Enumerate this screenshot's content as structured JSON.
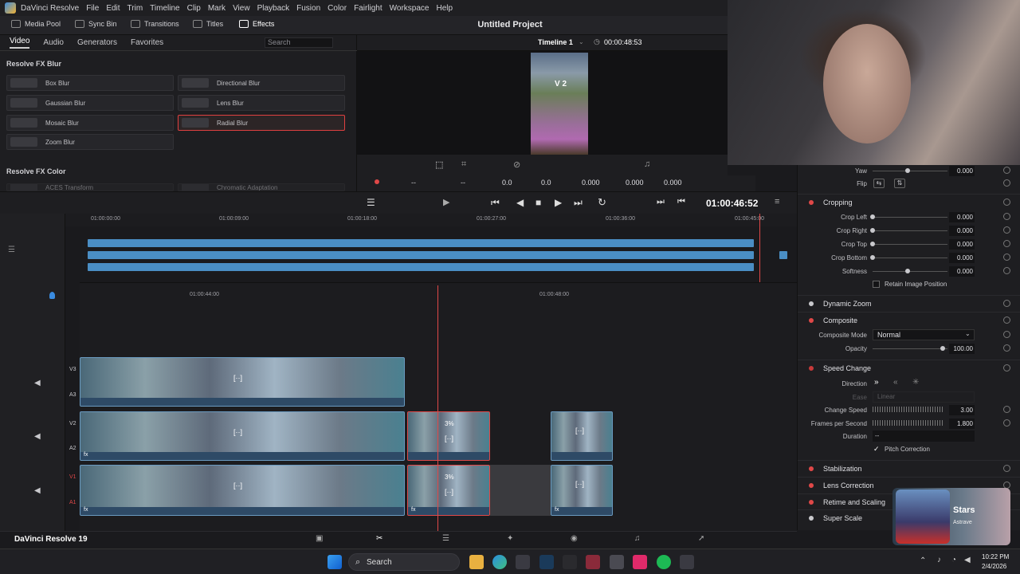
{
  "menu": [
    "DaVinci Resolve",
    "File",
    "Edit",
    "Trim",
    "Timeline",
    "Clip",
    "Mark",
    "View",
    "Playback",
    "Fusion",
    "Color",
    "Fairlight",
    "Workspace",
    "Help"
  ],
  "toolbar": {
    "media_pool": "Media Pool",
    "sync_bin": "Sync Bin",
    "transitions": "Transitions",
    "titles": "Titles",
    "effects": "Effects",
    "project": "Untitled Project",
    "timeline": "Timeline 1",
    "timecode": "00:00:48:53"
  },
  "library": {
    "tabs": [
      "Video",
      "Audio",
      "Generators",
      "Favorites"
    ],
    "search_placeholder": "Search",
    "section_blur": "Resolve FX Blur",
    "section_color": "Resolve FX Color",
    "effects": [
      "Box Blur",
      "Directional Blur",
      "Gaussian Blur",
      "Lens Blur",
      "Mosaic Blur",
      "Radial Blur",
      "Zoom Blur"
    ],
    "faded": [
      "ACES Transform",
      "Chromatic Adaptation"
    ]
  },
  "viewer": {
    "tags": "V 2",
    "values": [
      "0.0",
      "0.0",
      "0.000",
      "0.000",
      "0.000"
    ],
    "dash": "--"
  },
  "transport": {
    "timecode": "01:00:46:52"
  },
  "ruler_top": [
    "01:00:00:00",
    "01:00:09:00",
    "01:00:18:00",
    "01:00:27:00",
    "01:00:36:00",
    "01:00:45:00"
  ],
  "ruler_zoom": [
    "01:00:44:00",
    "01:00:48:00"
  ],
  "tracks": [
    {
      "video": "V3",
      "audio": "A3"
    },
    {
      "video": "V2",
      "audio": "A2"
    },
    {
      "video": "V1",
      "audio": "A1"
    }
  ],
  "mini_tracks": [
    "V3",
    "V2",
    "V1"
  ],
  "clip_badge": "3%",
  "clip_marker": "[··]",
  "fx_label": "fx",
  "inspector": {
    "yaw": {
      "label": "Yaw",
      "value": "0.000"
    },
    "flip": "Flip",
    "cropping": {
      "title": "Cropping",
      "rows": [
        {
          "label": "Crop Left",
          "value": "0.000"
        },
        {
          "label": "Crop Right",
          "value": "0.000"
        },
        {
          "label": "Crop Top",
          "value": "0.000"
        },
        {
          "label": "Crop Bottom",
          "value": "0.000"
        },
        {
          "label": "Softness",
          "value": "0.000"
        }
      ],
      "retain": "Retain Image Position"
    },
    "dynamic_zoom": "Dynamic Zoom",
    "composite": {
      "title": "Composite",
      "mode_label": "Composite Mode",
      "mode_value": "Normal",
      "opacity_label": "Opacity",
      "opacity_value": "100.00"
    },
    "speed": {
      "title": "Speed Change",
      "direction": "Direction",
      "ease": "Ease",
      "ease_value": "Linear",
      "change_speed_label": "Change Speed",
      "change_speed_value": "3.00",
      "fps_label": "Frames per Second",
      "fps_value": "1.800",
      "duration_label": "Duration",
      "duration_value": "--",
      "pitch": "Pitch Correction"
    },
    "sections": [
      "Stabilization",
      "Lens Correction",
      "Retime and Scaling",
      "Super Scale"
    ]
  },
  "bottom": {
    "app": "DaVinci Resolve 19"
  },
  "overlay": {
    "name": "Stars",
    "sub": "Astrave"
  },
  "taskbar": {
    "search": "Search",
    "time": "10:22 PM",
    "date": "2/4/2026"
  },
  "colors": {
    "accent_red": "#e04848",
    "clip_blue": "#4a8ec4"
  }
}
